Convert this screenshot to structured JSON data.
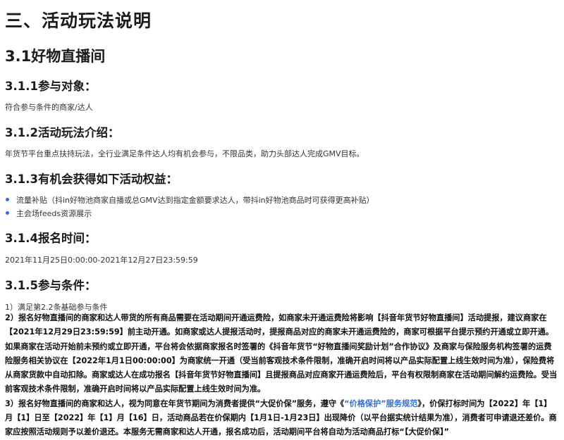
{
  "headings": {
    "section": "三、活动玩法说明",
    "sub": "3.1好物直播间",
    "participants": "3.1.1参与对象：",
    "intro": "3.1.2活动玩法介绍：",
    "benefits": "3.1.3有机会获得如下活动权益：",
    "signup_time": "3.1.4报名时间：",
    "conditions": "3.1.5参与条件："
  },
  "participants_text": "符合参与条件的商家/达人",
  "intro_text": "年货节平台重点扶持玩法，全行业满足条件达人均有机会参与，不限品类，助力头部达人完成GMV目标。",
  "benefits": [
    "流量补贴（抖in好物池商家自播或总GMV达到指定金额要求达人，带抖in好物池商品时可获得更高补贴）",
    "主会场feeds资源展示"
  ],
  "signup_time_text": "2021年11月25日0:00:00-2021年12月27日23:59:59",
  "condition_1": "1）满足第2.2条基础参与条件",
  "condition_2": "2）报名好物直播间的商家和达人带货的所有商品需要在活动期间开通运费险，如商家未开通运费险将影响【抖音年货节好物直播间】活动提报，建议商家在【2021年12月29日23:59:59】前主动开通。如商家或达人提报活动时，提报商品对应的商家未开通运费险的，商家可根据平台提示预约开通或立即开通。如果商家在活动开始前未预约或立即开通，平台将会依据商家报名时签署的《抖音年货节“好物直播间奖励计划”合作协议》及商家与保险服务机构签署的运费险服务相关协议在【2022年1月1日00:00:00】为商家统一开通（受当前客观技术条件限制，准确开启时间将以产品实际配置上线生效时间为准），保险费将从商家货款中自动扣除。商家或达人在成功报名【抖音年货节好物直播间】且提报商品对应商家开通运费险后，平台有权限制商家在活动期间解约运费险。受当前客观技术条件限制，准确开启时间将以产品实际配置上线生效时间为准。",
  "condition_3": {
    "before": "3）报名好物直播间的商家和达人，视为同意在年货节期间为消费者提供“大促价保”服务，遵守《",
    "link": "“价格保护”服务规范",
    "after": "》，价保打标时间为【2022】年【1】月【1】日至【2022】年【1】月【16】日，活动商品若在价保期内【1月1日-1月23日】出现降价（以平台据实统计结果为准），消费者可申请退还差价。商家应按照活动规则予以差价退还。本服务无需商家和达人开通，报名成功后，活动期间平台将自动为活动商品打标“【大促价保】”"
  }
}
